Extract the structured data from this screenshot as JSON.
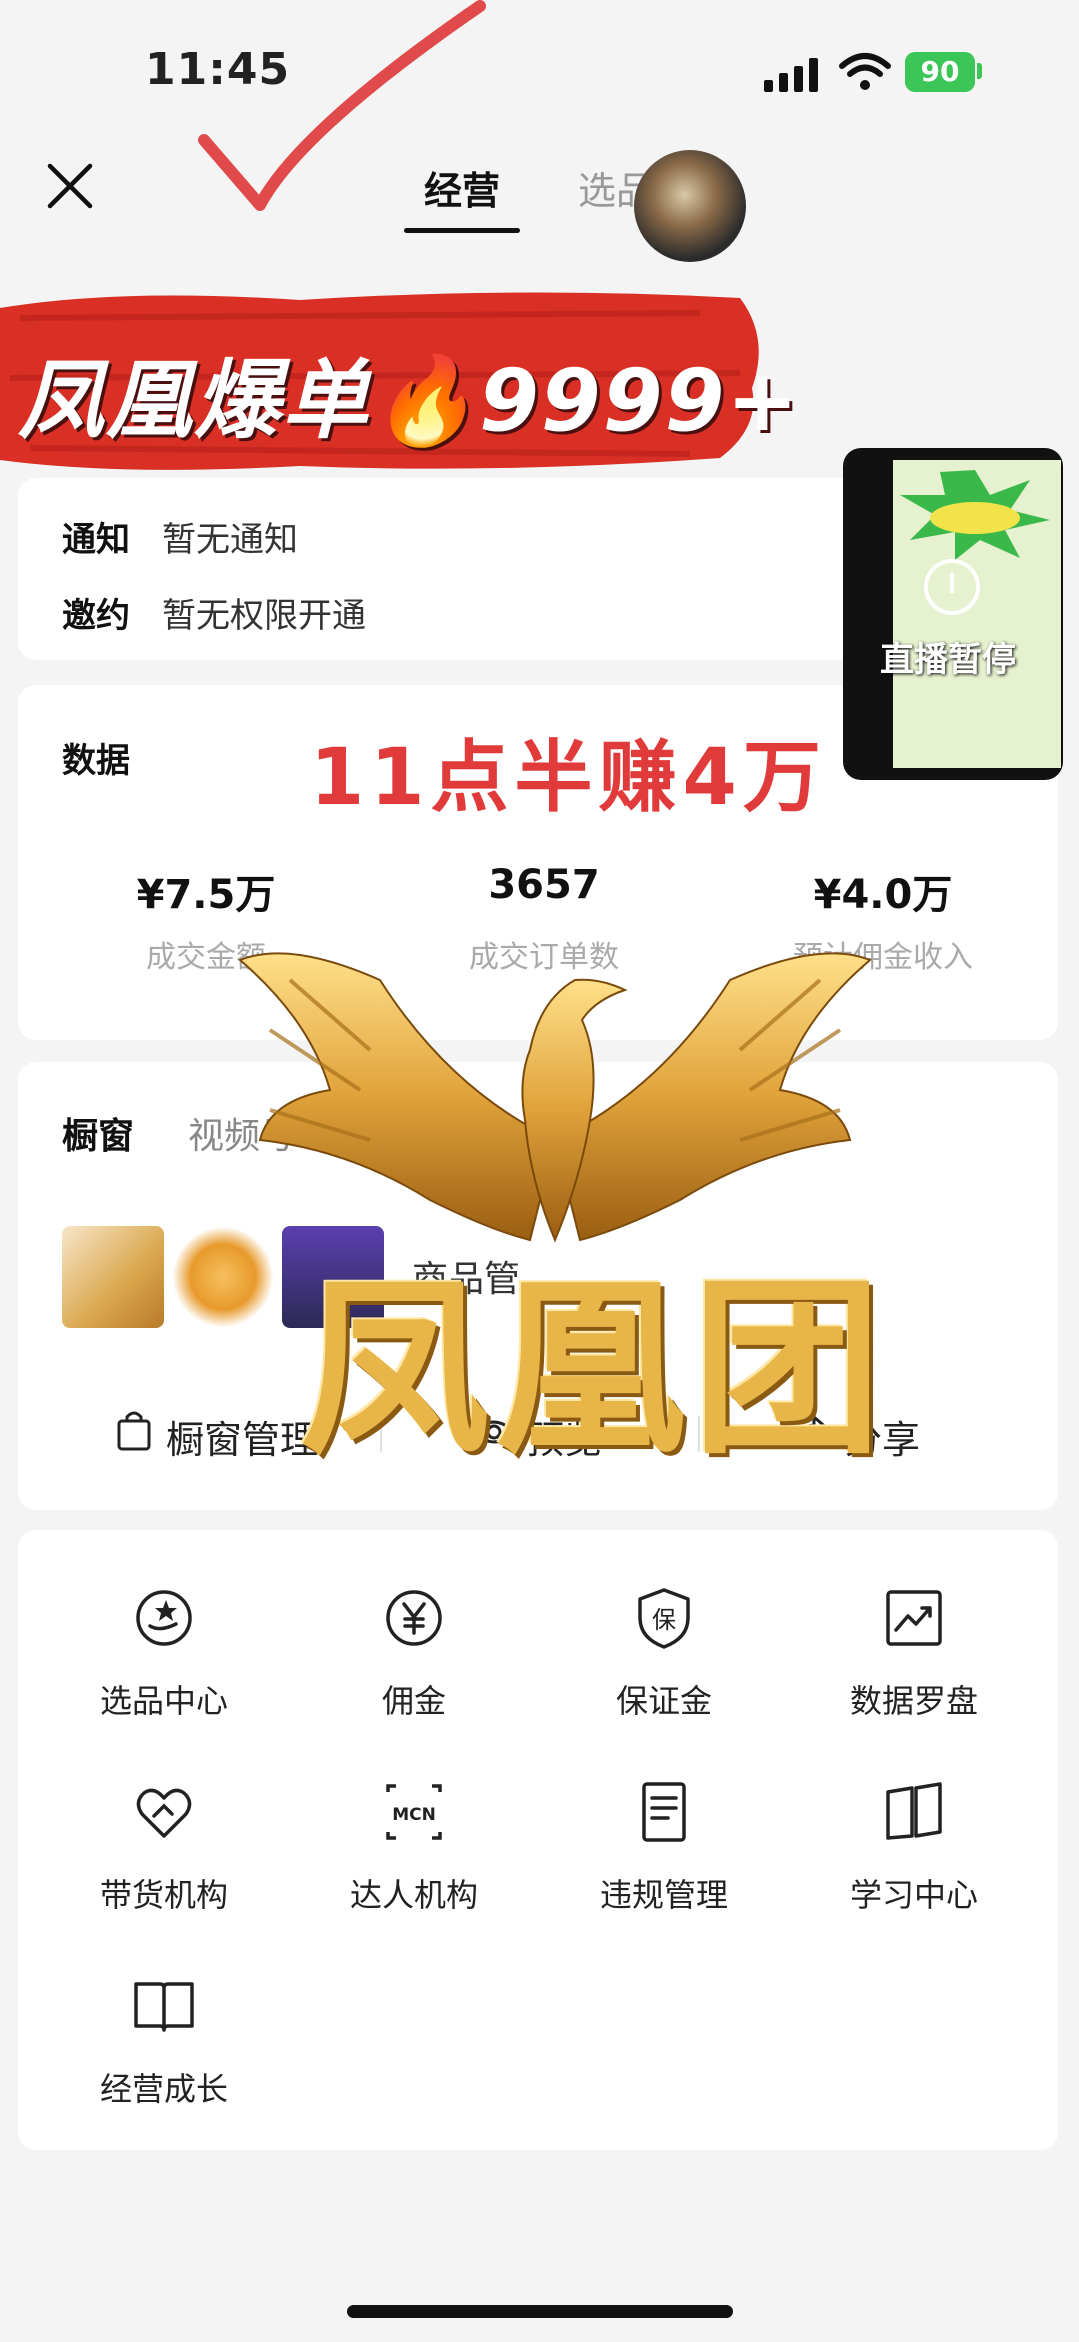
{
  "status_bar": {
    "time": "11:45",
    "battery": "90"
  },
  "header": {
    "tabs": [
      {
        "label": "经营",
        "active": true
      },
      {
        "label": "选品",
        "active": false
      }
    ]
  },
  "banner": {
    "text": "凤凰爆单🔥9999+"
  },
  "notify": {
    "rows": [
      {
        "label": "通知",
        "value": "暂无通知"
      },
      {
        "label": "邀约",
        "value": "暂无权限开通"
      }
    ]
  },
  "data_card": {
    "title": "数据",
    "promo": "11点半赚4万",
    "metrics": [
      {
        "value": "¥7.5万",
        "label": "成交金额"
      },
      {
        "value": "3657",
        "label": "成交订单数"
      },
      {
        "value": "¥4.0万",
        "label": "预计佣金收入"
      }
    ]
  },
  "live_preview": {
    "status": "直播暂停"
  },
  "window_card": {
    "tabs": [
      {
        "label": "橱窗",
        "active": true
      },
      {
        "label": "视频号",
        "active": false
      }
    ],
    "goods_label": "商品管",
    "actions": [
      "橱窗管理",
      "预览",
      "分享"
    ]
  },
  "tools": [
    {
      "label": "选品中心",
      "icon": "select-goods-icon"
    },
    {
      "label": "佣金",
      "icon": "yen-icon"
    },
    {
      "label": "保证金",
      "icon": "shield-bao-icon"
    },
    {
      "label": "数据罗盘",
      "icon": "trend-chart-icon"
    },
    {
      "label": "带货机构",
      "icon": "heart-handshake-icon"
    },
    {
      "label": "达人机构",
      "icon": "mcn-icon"
    },
    {
      "label": "违规管理",
      "icon": "document-icon"
    },
    {
      "label": "学习中心",
      "icon": "book-open-icon"
    },
    {
      "label": "经营成长",
      "icon": "book-icon"
    }
  ],
  "overlay": {
    "phoenix_text": "凤凰团"
  },
  "colors": {
    "accent_red": "#e03a3a",
    "battery_green": "#3bc657",
    "gold": "#e8b548"
  }
}
